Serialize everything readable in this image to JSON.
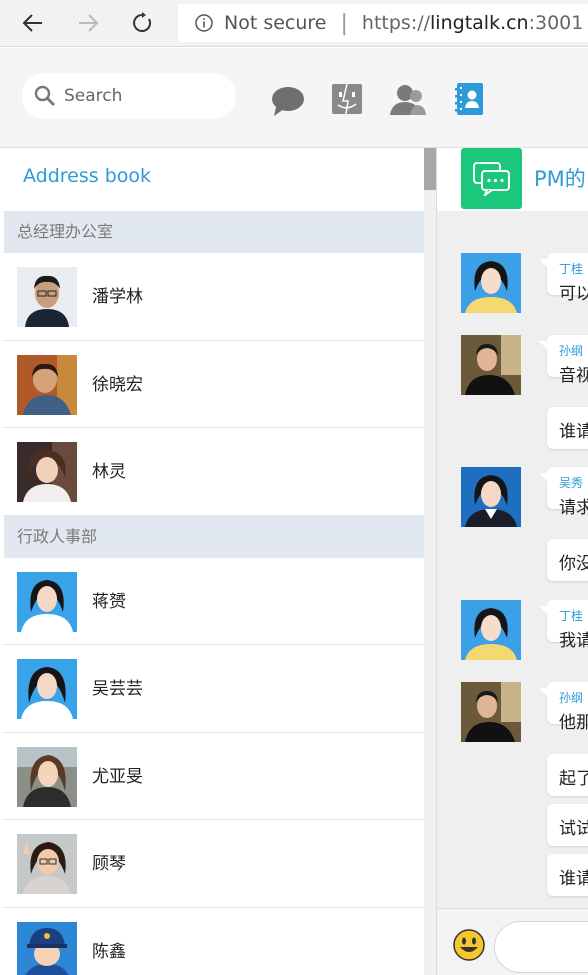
{
  "browser": {
    "security_label": "Not secure",
    "url_prefix": "https://",
    "url_host": "lingtalk.cn",
    "url_port": ":3001"
  },
  "search": {
    "placeholder": "Search"
  },
  "top_icons": [
    "chat-bubble-icon",
    "finder-face-icon",
    "contacts-person-icon",
    "address-book-icon"
  ],
  "colors": {
    "accent": "#2f9ad8",
    "group_green": "#1bc77a",
    "group_header_bg": "#e2e8ef"
  },
  "address_book": {
    "title": "Address book",
    "groups": [
      {
        "name": "总经理办公室",
        "contacts": [
          {
            "name": "潘学林"
          },
          {
            "name": "徐晓宏"
          },
          {
            "name": "林灵"
          }
        ]
      },
      {
        "name": "行政人事部",
        "contacts": [
          {
            "name": "蒋赟"
          },
          {
            "name": "吴芸芸"
          },
          {
            "name": "尤亚旻"
          },
          {
            "name": "顾琴"
          },
          {
            "name": "陈鑫"
          }
        ]
      }
    ]
  },
  "chat": {
    "title": "PM的",
    "messages": [
      {
        "sender": "丁桂",
        "lines": [
          "可以"
        ]
      },
      {
        "sender": "孙纲",
        "lines": [
          "音视",
          "谁请"
        ]
      },
      {
        "sender": "吴秀",
        "lines": [
          "请求",
          "你没"
        ]
      },
      {
        "sender": "丁桂",
        "lines": [
          "我请"
        ]
      },
      {
        "sender": "孙纲",
        "lines": [
          "他那",
          "起了",
          "试试",
          "谁请"
        ]
      }
    ]
  }
}
